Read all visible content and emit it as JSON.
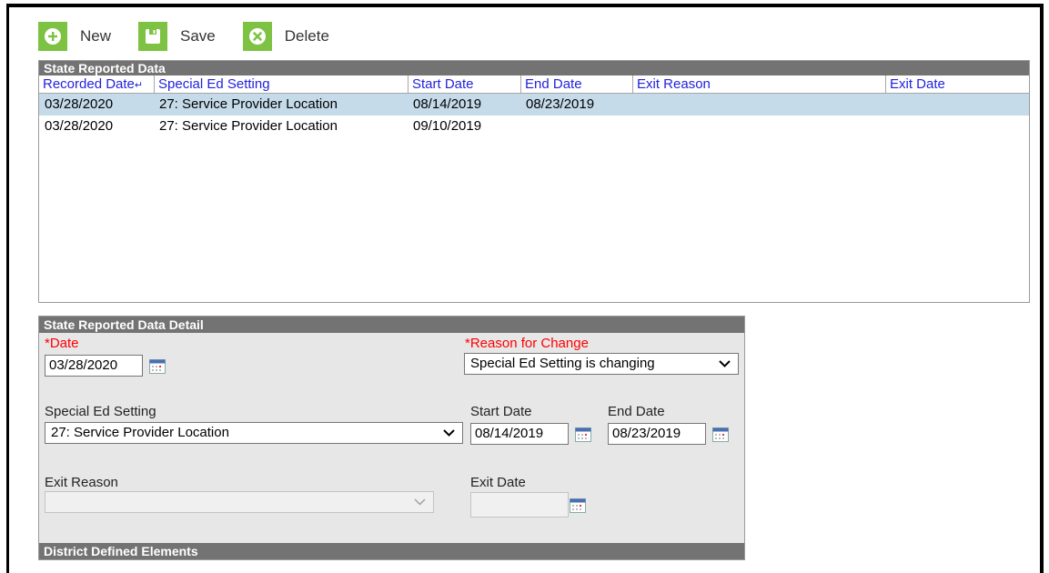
{
  "toolbar": {
    "new_label": "New",
    "save_label": "Save",
    "delete_label": "Delete",
    "accent": "#7dc242"
  },
  "grid": {
    "title": "State Reported Data",
    "columns": [
      "Recorded Date",
      "Special Ed Setting",
      "Start Date",
      "End Date",
      "Exit Reason",
      "Exit Date"
    ],
    "sort_indicator": "↵",
    "rows": [
      {
        "recorded": "03/28/2020",
        "setting": "27: Service Provider Location",
        "start": "08/14/2019",
        "end": "08/23/2019",
        "exit_reason": "",
        "exit_date": ""
      },
      {
        "recorded": "03/28/2020",
        "setting": "27: Service Provider Location",
        "start": "09/10/2019",
        "end": "",
        "exit_reason": "",
        "exit_date": ""
      }
    ]
  },
  "detail": {
    "title": "State Reported Data Detail",
    "date_label": "*Date",
    "date_value": "03/28/2020",
    "reason_label": "*Reason for Change",
    "reason_value": "Special Ed Setting is changing",
    "setting_label": "Special Ed Setting",
    "setting_value": "27: Service Provider Location",
    "start_label": "Start Date",
    "start_value": "08/14/2019",
    "end_label": "End Date",
    "end_value": "08/23/2019",
    "exit_reason_label": "Exit Reason",
    "exit_reason_value": "",
    "exit_date_label": "Exit Date",
    "exit_date_value": "",
    "district_title": "District Defined Elements"
  },
  "colors": {
    "panel_header": "#737373",
    "selected_row": "#c5dbe9",
    "header_link": "#2222dd",
    "required_label": "#ff0000"
  }
}
